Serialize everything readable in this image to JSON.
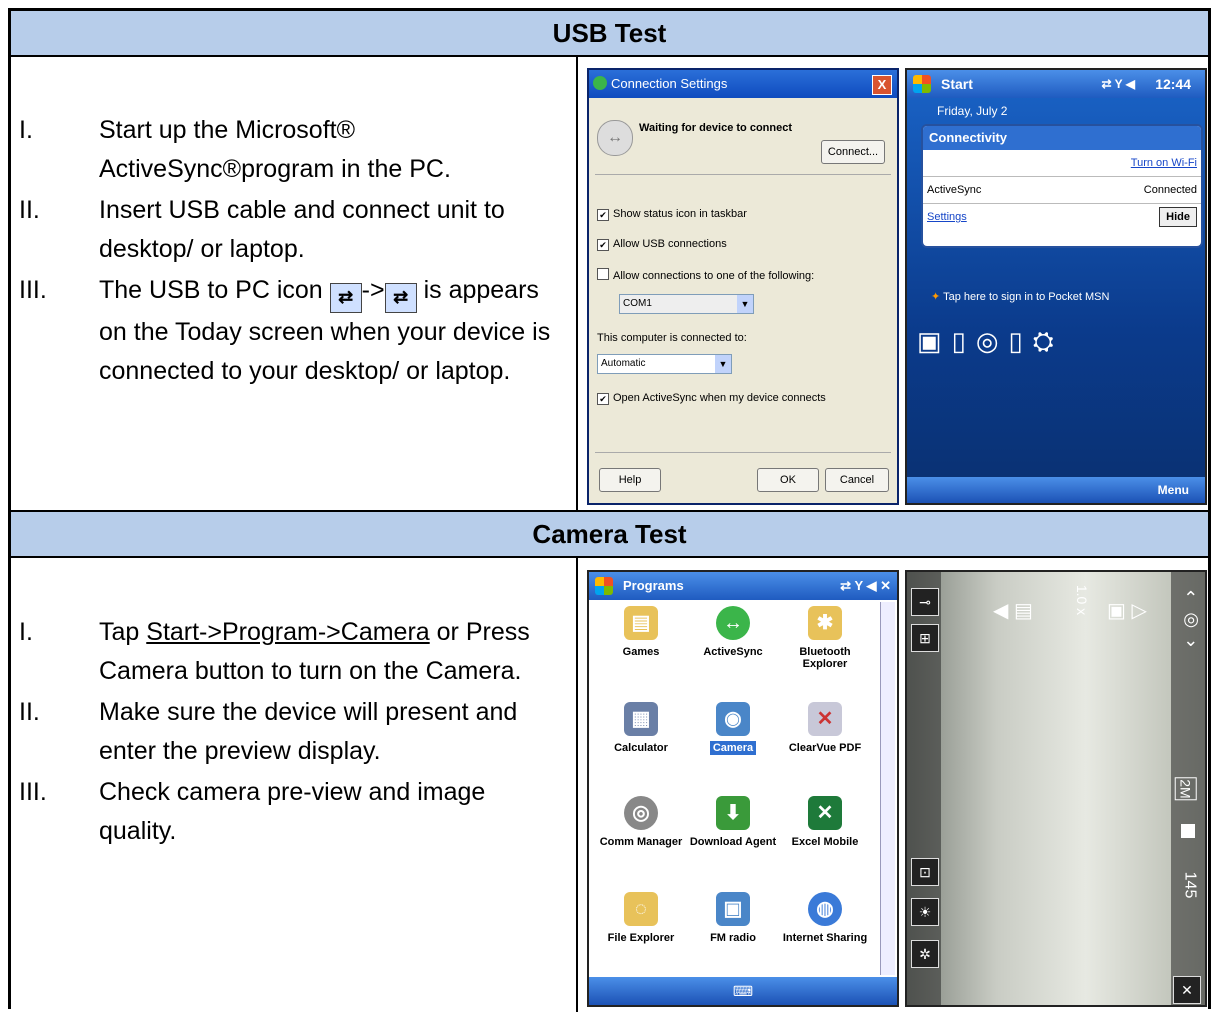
{
  "sections": {
    "usb": {
      "title": "USB Test",
      "steps": [
        {
          "num": "I.",
          "text": "Start up the Microsoft® ActiveSync®program in the PC."
        },
        {
          "num": "II.",
          "text": "Insert USB cable and connect unit to desktop/ or laptop."
        },
        {
          "num": "III.",
          "pre": "The USB to PC icon",
          "arrow": "->",
          "post": "is appears on the Today screen when your device is connected to your desktop/ or laptop."
        }
      ]
    },
    "camera": {
      "title": "Camera Test",
      "steps": [
        {
          "num": "I.",
          "pre": "Tap ",
          "link": "Start->Program->Camera",
          "post": " or Press Camera button to turn on the Camera."
        },
        {
          "num": "II.",
          "text": "Make sure the device will present and enter the preview display."
        },
        {
          "num": "III.",
          "text": "Check camera pre-view and image quality."
        }
      ]
    }
  },
  "dialog": {
    "title": "Connection Settings",
    "status": "Waiting for device to connect",
    "connect": "Connect...",
    "opt1": "Show status icon in taskbar",
    "opt2": "Allow USB connections",
    "opt3": "Allow connections to one of the following:",
    "port": "COM1",
    "connected_to_label": "This computer is connected to:",
    "connected_to": "Automatic",
    "opt4": "Open ActiveSync when my device connects",
    "help": "Help",
    "ok": "OK",
    "cancel": "Cancel"
  },
  "today": {
    "start": "Start",
    "time": "12:44",
    "date": "Friday, July 2",
    "popup_title": "Connectivity",
    "wifi_link": "Turn on Wi-Fi",
    "activesync": "ActiveSync",
    "activesync_status": "Connected",
    "settings": "Settings",
    "hide": "Hide",
    "msn": "Tap here to sign in to Pocket MSN",
    "menu": "Menu"
  },
  "programs": {
    "title": "Programs",
    "items": [
      "Games",
      "ActiveSync",
      "Bluetooth Explorer",
      "Calculator",
      "Camera",
      "ClearVue PDF",
      "Comm Manager",
      "Download Agent",
      "Excel Mobile",
      "File Explorer",
      "FM radio",
      "Internet Sharing"
    ]
  },
  "camera_view": {
    "zoom": "1.0 x",
    "res": "2M",
    "count": "145"
  }
}
